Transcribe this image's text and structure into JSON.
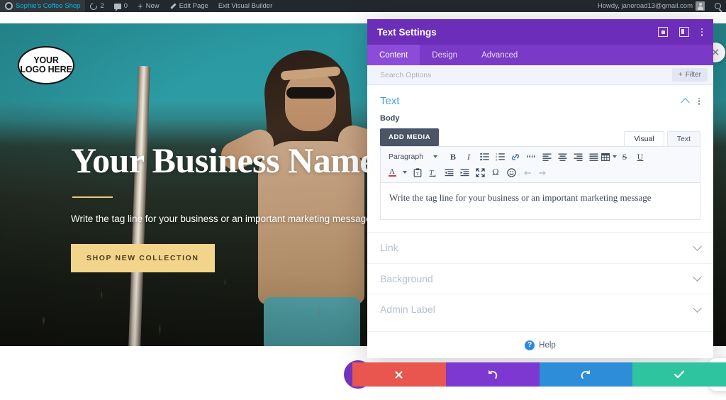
{
  "adminbar": {
    "site_name": "Sophie's Coffee Shop",
    "updates_count": "2",
    "comments_count": "0",
    "new_label": "New",
    "edit_page_label": "Edit Page",
    "exit_builder_label": "Exit Visual Builder",
    "howdy": "Howdy, janeroad13@gmail.com"
  },
  "hero": {
    "logo_line1": "YOUR",
    "logo_line2": "LOGO HERE",
    "title": "Your Business Name",
    "subtitle": "Write the tag line for your business or an important marketing message",
    "cta_label": "SHOP NEW COLLECTION",
    "accent_color": "#f2d58b",
    "sky_color": "#2f9ca3"
  },
  "modal": {
    "title": "Text Settings",
    "brand_color": "#6c2eb9",
    "tabs": [
      {
        "label": "Content",
        "active": true
      },
      {
        "label": "Design",
        "active": false
      },
      {
        "label": "Advanced",
        "active": false
      }
    ],
    "search_placeholder": "Search Options",
    "filter_label": "Filter",
    "section": {
      "title": "Text",
      "field_label": "Body",
      "add_media_label": "ADD MEDIA",
      "editor_modes": [
        {
          "label": "Visual",
          "active": true
        },
        {
          "label": "Text",
          "active": false
        }
      ],
      "format_select": "Paragraph",
      "editor_value": "Write the tag line for your business or an important marketing message",
      "toolbar_row1": [
        "bold-icon",
        "italic-icon",
        "bulleted-list-icon",
        "numbered-list-icon",
        "link-icon",
        "blockquote-icon",
        "align-left-icon",
        "align-center-icon",
        "align-right-icon",
        "align-justify-icon",
        "table-icon",
        "strikethrough-icon",
        "underline-icon"
      ],
      "toolbar_row2": [
        "text-color-icon",
        "paste-as-text-icon",
        "clear-formatting-icon",
        "outdent-icon",
        "indent-icon",
        "fullscreen-icon",
        "special-character-icon",
        "emoji-icon",
        "undo-icon",
        "redo-icon"
      ]
    },
    "accordions": [
      {
        "label": "Link"
      },
      {
        "label": "Background"
      },
      {
        "label": "Admin Label"
      }
    ],
    "help_label": "Help"
  },
  "actionbar": {
    "buttons": [
      {
        "name": "discard-button",
        "icon": "close-icon",
        "color": "#e8564f"
      },
      {
        "name": "undo-button",
        "icon": "undo-icon",
        "color": "#7c38d0"
      },
      {
        "name": "redo-button",
        "icon": "redo-icon",
        "color": "#2e8dd8"
      },
      {
        "name": "save-button",
        "icon": "check-icon",
        "color": "#2ec4a0"
      }
    ]
  }
}
